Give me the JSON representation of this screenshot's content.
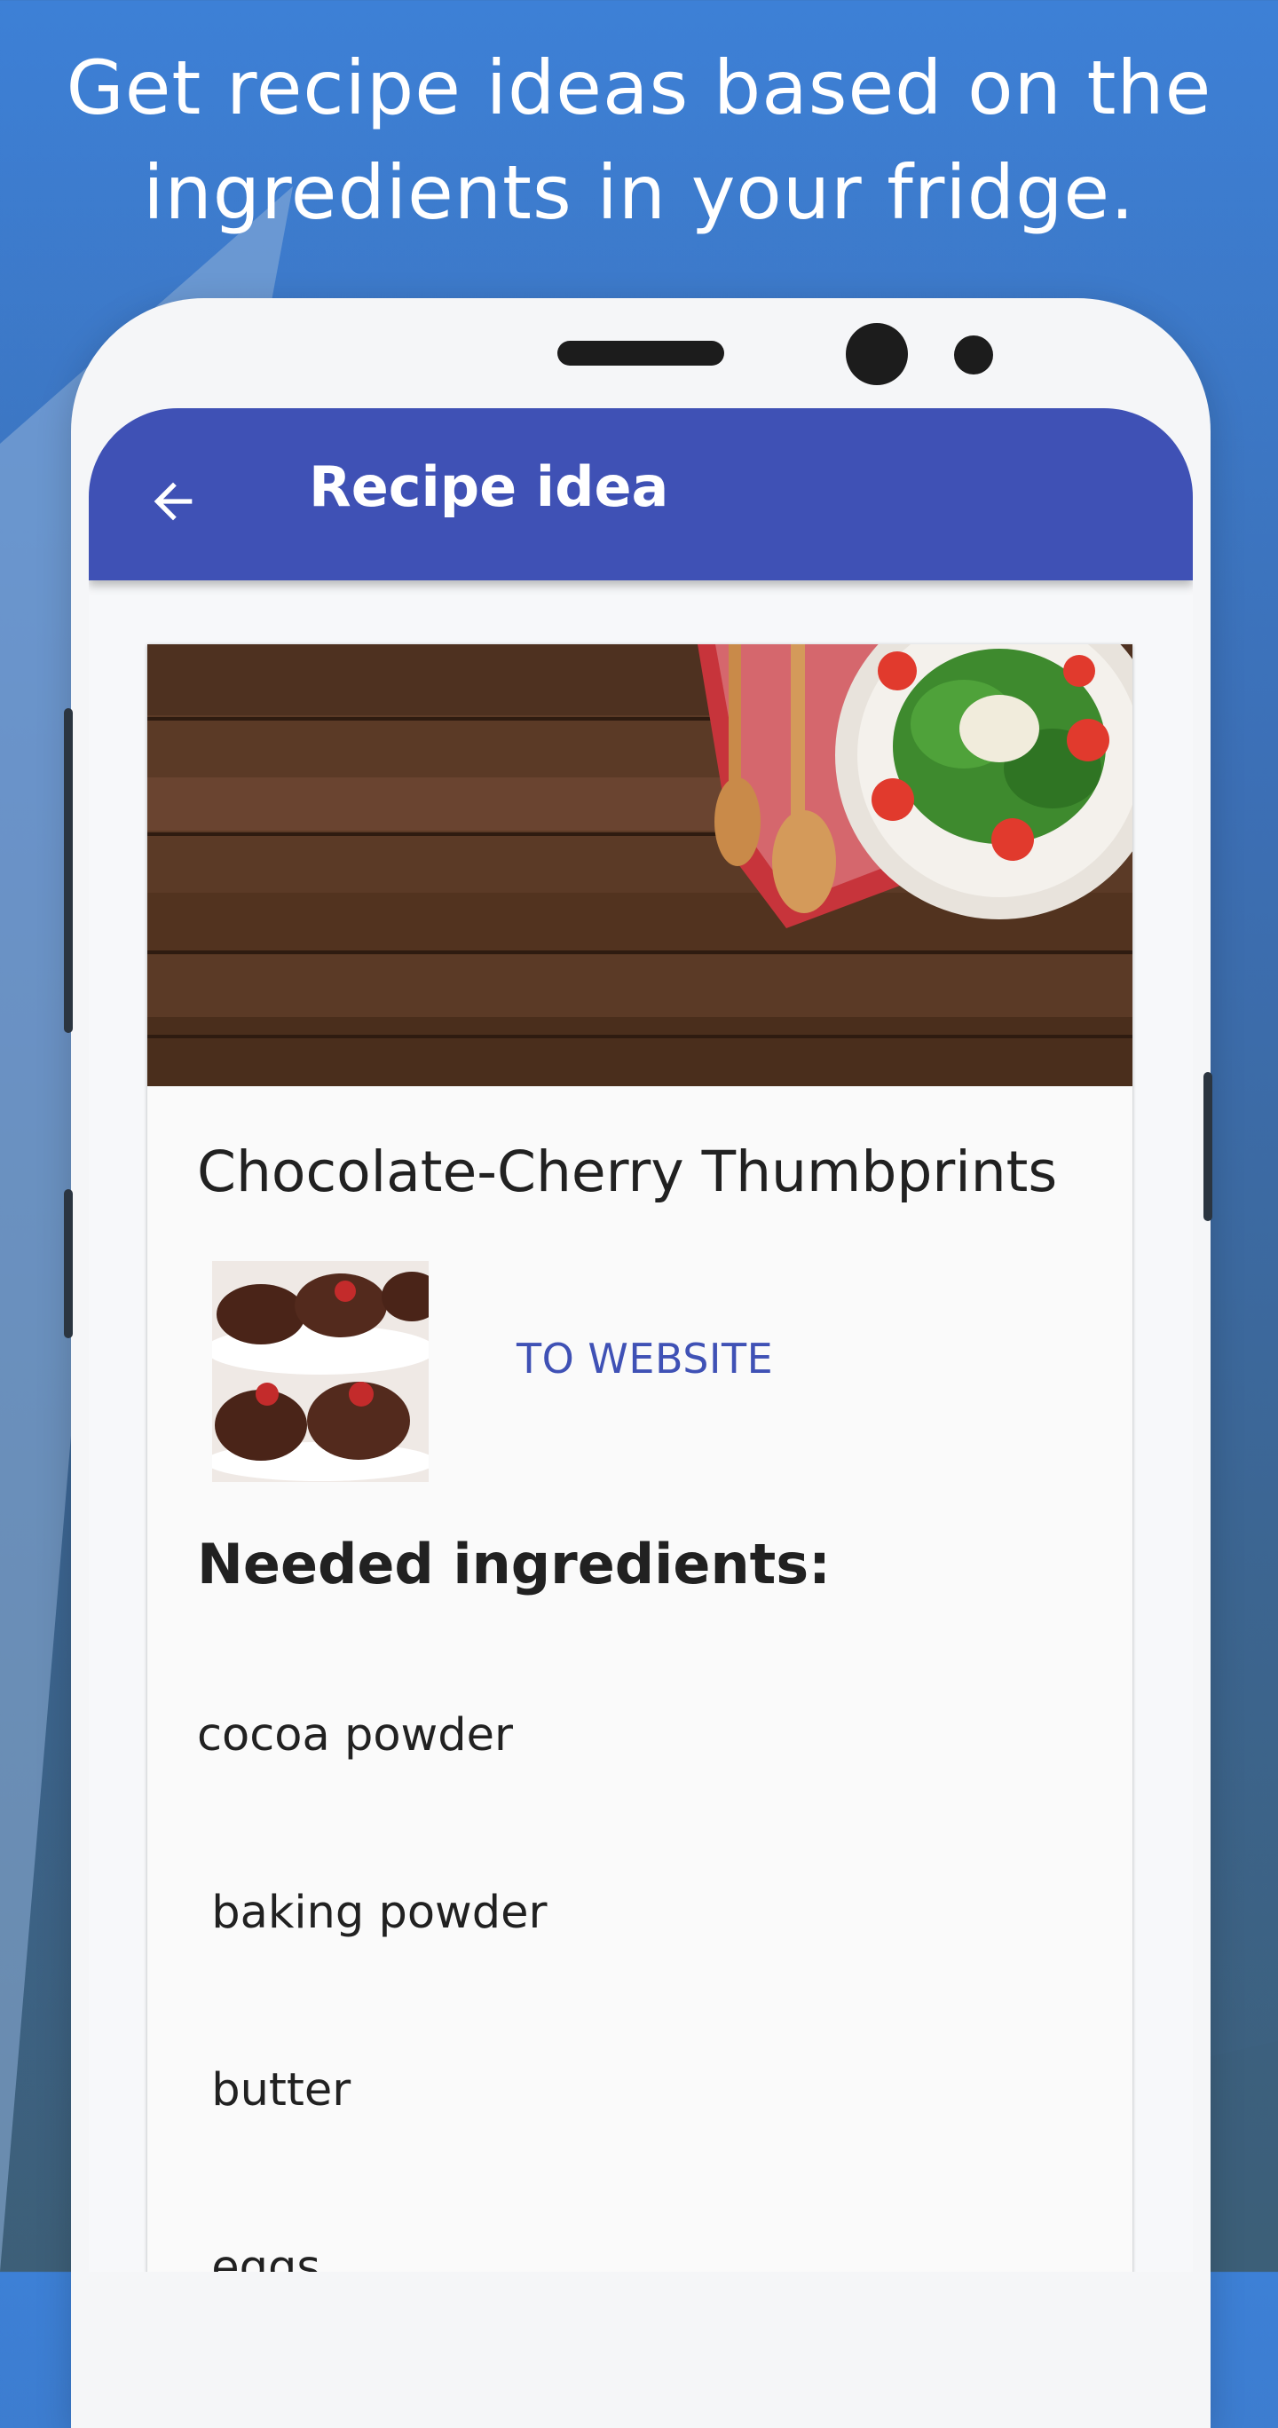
{
  "headline": {
    "line1": "Get recipe ideas based on the",
    "line2": "ingredients in your fridge."
  },
  "appbar": {
    "back_icon": "arrow-back-icon",
    "title": "Recipe idea"
  },
  "recipe": {
    "title": "Chocolate-Cherry Thumbprints",
    "website_button": "TO WEBSITE",
    "ingredients_heading": "Needed ingredients:",
    "ingredients": [
      "cocoa powder",
      " baking powder",
      " butter",
      " eggs"
    ]
  },
  "colors": {
    "appbar": "#3f51b5",
    "accent_text": "#3f51b5",
    "background_top": "#3d80d6",
    "background_bottom": "#3d5f78"
  }
}
